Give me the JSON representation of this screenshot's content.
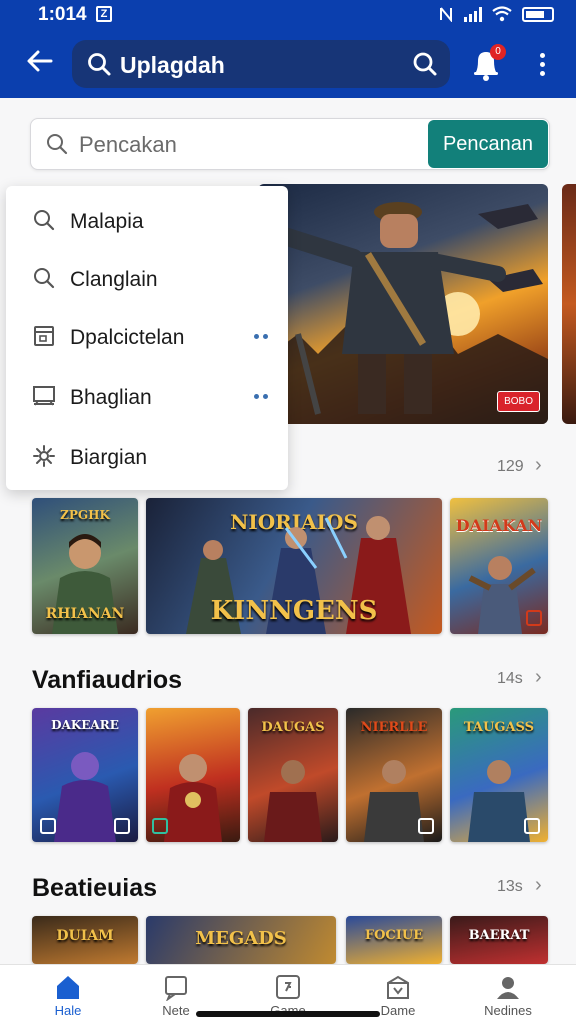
{
  "status_bar": {
    "time": "1:014",
    "app_badge": "Z"
  },
  "header": {
    "search_text": "Uplagdah",
    "notification_badge": "0"
  },
  "search": {
    "placeholder": "Pencakan",
    "button_label": "Pencanan"
  },
  "dropdown": {
    "items": [
      {
        "label": "Malapia",
        "icon": "search-icon"
      },
      {
        "label": "Clanglain",
        "icon": "search-icon"
      },
      {
        "label": "Dpalcictelan",
        "icon": "window-icon",
        "has_more": true
      },
      {
        "label": "Bhaglian",
        "icon": "monitor-icon",
        "has_more": true
      },
      {
        "label": "Biargian",
        "icon": "gear-icon"
      }
    ]
  },
  "hero": {
    "tag": "BOBO"
  },
  "sections": [
    {
      "title": "",
      "count": "129",
      "cards": [
        {
          "caption_top": "ZPGHK",
          "caption": "RHIANAN",
          "colors": [
            "#2f4f7a",
            "#6a8a6a",
            "#3a2a20"
          ]
        },
        {
          "caption_top": "NIORIAIOS",
          "caption": "KINNGENS",
          "colors": [
            "#1a2238",
            "#3a5a8a",
            "#c45a20"
          ]
        },
        {
          "caption_top": "",
          "caption": "DAIAKAN",
          "colors": [
            "#f0c040",
            "#3a6aa0",
            "#7a2a20"
          ]
        }
      ]
    },
    {
      "title": "Vanfiaudrios",
      "count": "14s",
      "cards": [
        {
          "caption": "DAKEARE",
          "colors": [
            "#5a3aa0",
            "#2a5ab0",
            "#1a1a40"
          ]
        },
        {
          "caption": "",
          "colors": [
            "#f0a030",
            "#c03020",
            "#3a1a10"
          ]
        },
        {
          "caption": "DAUGAS",
          "colors": [
            "#4a2a2a",
            "#c04a2a",
            "#2a1a1a"
          ]
        },
        {
          "caption": "NIERLLE",
          "colors": [
            "#2a2a2a",
            "#c07030",
            "#1a1a1a"
          ]
        },
        {
          "caption": "TAUGASS",
          "colors": [
            "#2a9a7a",
            "#3a6ac0",
            "#f0b030"
          ]
        }
      ]
    },
    {
      "title": "Beatieuias",
      "count": "13s",
      "cards": [
        {
          "caption": "DUIAM",
          "colors": [
            "#3a2a1a",
            "#c07a30"
          ]
        },
        {
          "caption": "MEGADS",
          "colors": [
            "#2a3a6a",
            "#c08a30"
          ]
        },
        {
          "caption": "FOCIUE",
          "colors": [
            "#2a4a9a",
            "#f0b030"
          ]
        },
        {
          "caption": "BAERAT",
          "colors": [
            "#3a1a1a",
            "#c03030"
          ]
        }
      ]
    }
  ],
  "bottom_nav": [
    {
      "label": "Hale",
      "icon": "home-icon",
      "active": true
    },
    {
      "label": "Nete",
      "icon": "message-icon"
    },
    {
      "label": "Game",
      "icon": "puzzle-icon"
    },
    {
      "label": "Dame",
      "icon": "store-icon"
    },
    {
      "label": "Nedines",
      "icon": "profile-icon"
    }
  ],
  "colors": {
    "primary": "#0b3fae",
    "accent": "#12807a",
    "nav_active": "#1a5fd0"
  }
}
